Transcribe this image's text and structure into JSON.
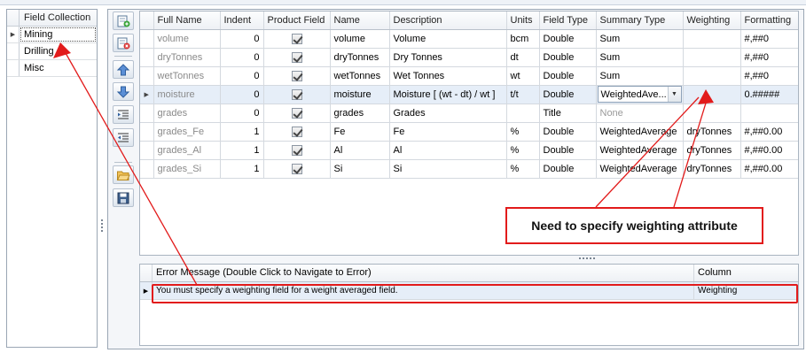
{
  "left_panel": {
    "header": "Field Collection",
    "items": [
      {
        "label": "Mining",
        "active": true
      },
      {
        "label": "Drilling",
        "active": false
      },
      {
        "label": "Misc",
        "active": false
      }
    ]
  },
  "toolbar": {
    "buttons": [
      {
        "icon": "add-row-icon"
      },
      {
        "icon": "delete-row-icon"
      },
      {
        "icon": "move-up-icon"
      },
      {
        "icon": "move-down-icon"
      },
      {
        "icon": "indent-icon"
      },
      {
        "icon": "outdent-icon"
      },
      {
        "icon": "open-folder-icon"
      },
      {
        "icon": "save-icon"
      }
    ]
  },
  "fields_grid": {
    "columns": [
      "Full Name",
      "Indent",
      "Product Field",
      "Name",
      "Description",
      "Units",
      "Field Type",
      "Summary Type",
      "Weighting",
      "Formatting"
    ],
    "rows": [
      {
        "full_name": "volume",
        "indent": "0",
        "product": true,
        "name": "volume",
        "description": "Volume",
        "units": "bcm",
        "field_type": "Double",
        "summary_type": "Sum",
        "weighting": "",
        "formatting": "#,##0"
      },
      {
        "full_name": "dryTonnes",
        "indent": "0",
        "product": true,
        "name": "dryTonnes",
        "description": "Dry Tonnes",
        "units": "dt",
        "field_type": "Double",
        "summary_type": "Sum",
        "weighting": "",
        "formatting": "#,##0"
      },
      {
        "full_name": "wetTonnes",
        "indent": "0",
        "product": true,
        "name": "wetTonnes",
        "description": "Wet Tonnes",
        "units": "wt",
        "field_type": "Double",
        "summary_type": "Sum",
        "weighting": "",
        "formatting": "#,##0"
      },
      {
        "full_name": "moisture",
        "indent": "0",
        "product": true,
        "name": "moisture",
        "description": "Moisture [ (wt - dt) / wt ]",
        "units": "t/t",
        "field_type": "Double",
        "summary_type": "WeightedAve...",
        "weighting": "",
        "formatting": "0.#####"
      },
      {
        "full_name": "grades",
        "indent": "0",
        "product": true,
        "name": "grades",
        "description": "Grades",
        "units": "",
        "field_type": "Title",
        "summary_type": "None",
        "weighting": "",
        "formatting": ""
      },
      {
        "full_name": "grades_Fe",
        "indent": "1",
        "product": true,
        "name": "Fe",
        "description": " Fe",
        "units": "%",
        "field_type": "Double",
        "summary_type": "WeightedAverage",
        "weighting": "dryTonnes",
        "formatting": "#,##0.00"
      },
      {
        "full_name": "grades_Al",
        "indent": "1",
        "product": true,
        "name": "Al",
        "description": " Al",
        "units": "%",
        "field_type": "Double",
        "summary_type": "WeightedAverage",
        "weighting": "dryTonnes",
        "formatting": "#,##0.00"
      },
      {
        "full_name": "grades_Si",
        "indent": "1",
        "product": true,
        "name": "Si",
        "description": " Si",
        "units": "%",
        "field_type": "Double",
        "summary_type": "WeightedAverage",
        "weighting": "dryTonnes",
        "formatting": "#,##0.00"
      }
    ]
  },
  "error_grid": {
    "columns": [
      "Error Message (Double Click to Navigate to Error)",
      "Column"
    ],
    "rows": [
      {
        "message": "You must specify a weighting field for a weight averaged field.",
        "column": "Weighting"
      }
    ]
  },
  "annotation": {
    "callout_text": "Need to specify weighting attribute",
    "color": "#e21b1b"
  }
}
